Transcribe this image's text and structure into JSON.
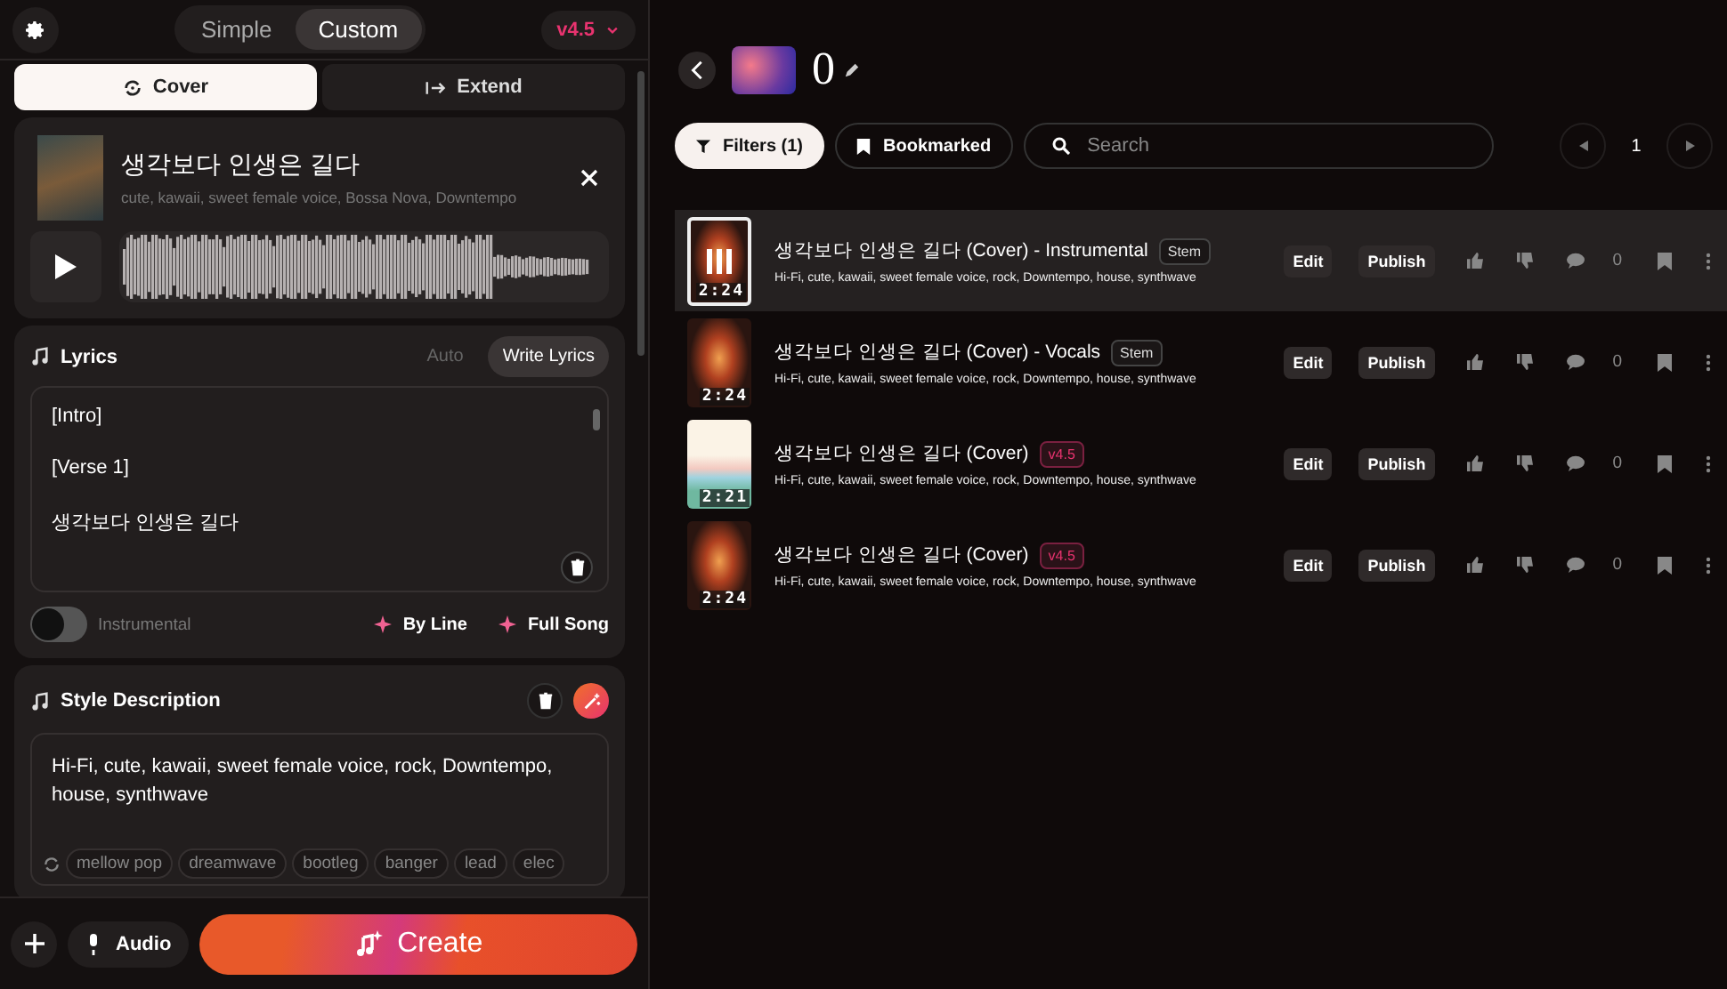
{
  "top_bar": {
    "mode_tabs": [
      {
        "label": "Simple",
        "selected": false
      },
      {
        "label": "Custom",
        "selected": true
      }
    ],
    "model": "v4.5"
  },
  "action_tabs": [
    {
      "label": "Cover",
      "kind": "cover",
      "selected": true
    },
    {
      "label": "Extend",
      "kind": "extend",
      "selected": false
    }
  ],
  "source_song": {
    "title": "생각보다 인생은 길다",
    "tags": "cute, kawaii, sweet female voice, Bossa Nova, Downtempo"
  },
  "lyrics": {
    "title": "Lyrics",
    "modes": [
      {
        "label": "Auto",
        "selected": false
      },
      {
        "label": "Write Lyrics",
        "selected": true
      }
    ],
    "lines": [
      "[Intro]",
      "[Verse 1]",
      "생각보다 인생은 길다"
    ],
    "instrumental": {
      "label": "Instrumental",
      "on": false
    },
    "actions": [
      "By Line",
      "Full Song"
    ]
  },
  "style": {
    "title": "Style Description",
    "value": "Hi-Fi, cute, kawaii, sweet female voice, rock, Downtempo, house, synthwave",
    "suggestions": [
      "mellow pop",
      "dreamwave",
      "bootleg",
      "banger",
      "lead",
      "elec"
    ]
  },
  "bottom_bar": {
    "audio": "Audio",
    "create": "Create"
  },
  "workspace": {
    "title": "0",
    "filters": "Filters (1)",
    "bookmarked": "Bookmarked",
    "search_placeholder": "Search",
    "page": "1"
  },
  "songs": [
    {
      "title": "생각보다 인생은 길다 (Cover) - Instrumental",
      "badge": {
        "kind": "stem",
        "label": "Stem"
      },
      "tags": "Hi-Fi, cute, kawaii, sweet female voice, rock, Downtempo, house, synthwave",
      "duration": "2:24",
      "kind": "carousel",
      "selected": true,
      "edit": "Edit",
      "publish": "Publish",
      "comments": "0"
    },
    {
      "title": "생각보다 인생은 길다 (Cover) - Vocals",
      "badge": {
        "kind": "stem",
        "label": "Stem"
      },
      "tags": "Hi-Fi, cute, kawaii, sweet female voice, rock, Downtempo, house, synthwave",
      "duration": "2:24",
      "kind": "carousel",
      "selected": false,
      "edit": "Edit",
      "publish": "Publish",
      "comments": "0"
    },
    {
      "title": "생각보다 인생은 길다 (Cover)",
      "badge": {
        "kind": "model",
        "label": "v4.5"
      },
      "tags": "Hi-Fi, cute, kawaii, sweet female voice, rock, Downtempo, house, synthwave",
      "duration": "2:21",
      "kind": "hills",
      "selected": false,
      "edit": "Edit",
      "publish": "Publish",
      "comments": "0"
    },
    {
      "title": "생각보다 인생은 길다 (Cover)",
      "badge": {
        "kind": "model",
        "label": "v4.5"
      },
      "tags": "Hi-Fi, cute, kawaii, sweet female voice, rock, Downtempo, house, synthwave",
      "duration": "2:24",
      "kind": "carousel",
      "selected": false,
      "edit": "Edit",
      "publish": "Publish",
      "comments": "0"
    }
  ]
}
